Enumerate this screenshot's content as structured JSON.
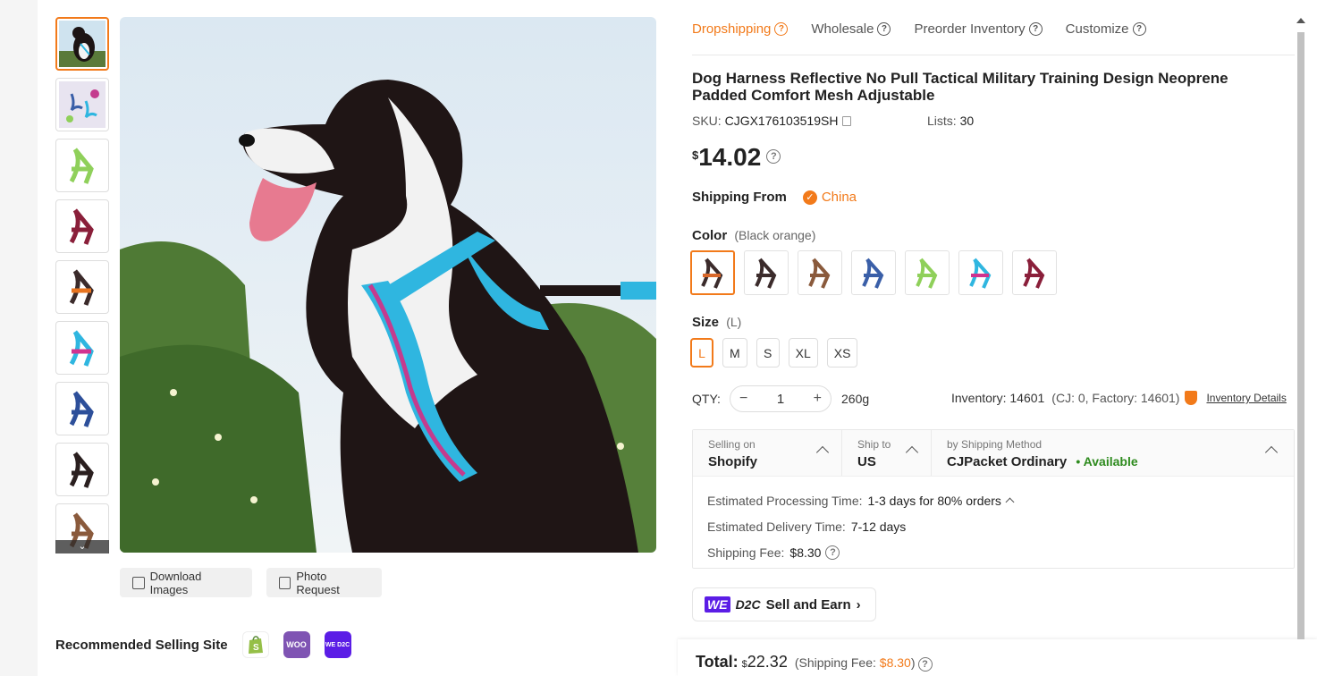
{
  "tabs": [
    {
      "label": "Dropshipping"
    },
    {
      "label": "Wholesale"
    },
    {
      "label": "Preorder Inventory"
    },
    {
      "label": "Customize"
    }
  ],
  "product": {
    "title": "Dog Harness Reflective No Pull Tactical Military Training Design Neoprene Padded Comfort Mesh Adjustable",
    "sku_label": "SKU:",
    "sku": "CJGX176103519SH",
    "lists_label": "Lists:",
    "lists": "30",
    "price_currency": "$",
    "price": "14.02"
  },
  "shipping_from": {
    "label": "Shipping From",
    "value": "China"
  },
  "color": {
    "label": "Color",
    "selected": "(Black orange)",
    "swatch_colors": [
      "#d9682a",
      "#3b2b2b",
      "#8a5a3c",
      "#3a5fa8",
      "#8fd05a",
      "#2fb6e0",
      "#8a1f3a"
    ]
  },
  "size": {
    "label": "Size",
    "selected": "(L)",
    "options": [
      "L",
      "M",
      "S",
      "XL",
      "XS"
    ]
  },
  "qty": {
    "label": "QTY:",
    "minus": "−",
    "plus": "+",
    "value": "1",
    "weight": "260g"
  },
  "inventory": {
    "text": "Inventory: 14601",
    "detail": "(CJ: 0, Factory: 14601)",
    "link": "Inventory Details"
  },
  "shipping": {
    "selling_on_label": "Selling on",
    "selling_on": "Shopify",
    "ship_to_label": "Ship to",
    "ship_to": "US",
    "method_label": "by Shipping Method",
    "method": "CJPacket Ordinary",
    "available": "• Available",
    "processing_label": "Estimated Processing Time:",
    "processing": "1-3 days for 80% orders",
    "delivery_label": "Estimated Delivery Time:",
    "delivery": "7-12 days",
    "fee_label": "Shipping Fee:",
    "fee": "$8.30"
  },
  "d2c": {
    "we": "WE",
    "d2c": "D2C",
    "label": "Sell and Earn",
    "arrow": "›"
  },
  "gallery": {
    "download_label": "Download Images",
    "photo_request_label": "Photo Request",
    "more": "⌄"
  },
  "recommended": {
    "label": "Recommended Selling Site",
    "sites": [
      {
        "name": "shopify-icon",
        "color": "#95bf47",
        "text": ""
      },
      {
        "name": "woocommerce-icon",
        "color": "#7f54b3",
        "text": "WOO"
      },
      {
        "name": "wed2c-icon",
        "color": "#5b1de6",
        "text": "WE D2C"
      }
    ]
  },
  "total": {
    "label": "Total:",
    "currency": "$",
    "amount": "22.32",
    "fee_prefix": "(Shipping Fee:",
    "fee": "$8.30",
    "fee_suffix": ")"
  },
  "help_glyph": "?"
}
